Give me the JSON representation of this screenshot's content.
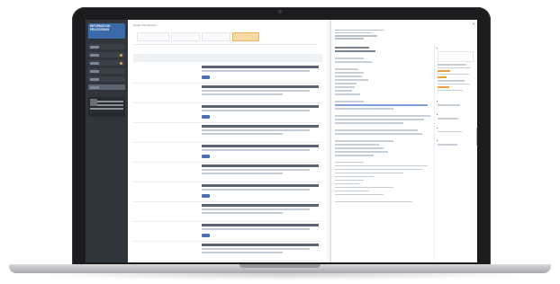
{
  "app": {
    "logo_text": "INFORMATION\nPROCESSING"
  },
  "main": {
    "breadcrumb": "Home / Documents",
    "toolbar": [
      "",
      "",
      "",
      ""
    ],
    "subbar": "",
    "columns": [
      "",
      "",
      ""
    ],
    "rows": [
      {
        "c1": "",
        "c2": ""
      },
      {
        "c1": "",
        "c2": ""
      },
      {
        "c1": "",
        "c2": ""
      },
      {
        "c1": "",
        "c2": ""
      },
      {
        "c1": "",
        "c2": ""
      },
      {
        "c1": "",
        "c2": ""
      },
      {
        "c1": "",
        "c2": ""
      },
      {
        "c1": "",
        "c2": ""
      },
      {
        "c1": "",
        "c2": ""
      },
      {
        "c1": "",
        "c2": ""
      }
    ]
  },
  "panel": {
    "title": "",
    "close_icon": "close-icon"
  },
  "colors": {
    "sidebar": "#2f353b",
    "accent": "#f0a03c",
    "link": "#4d6fb3"
  }
}
